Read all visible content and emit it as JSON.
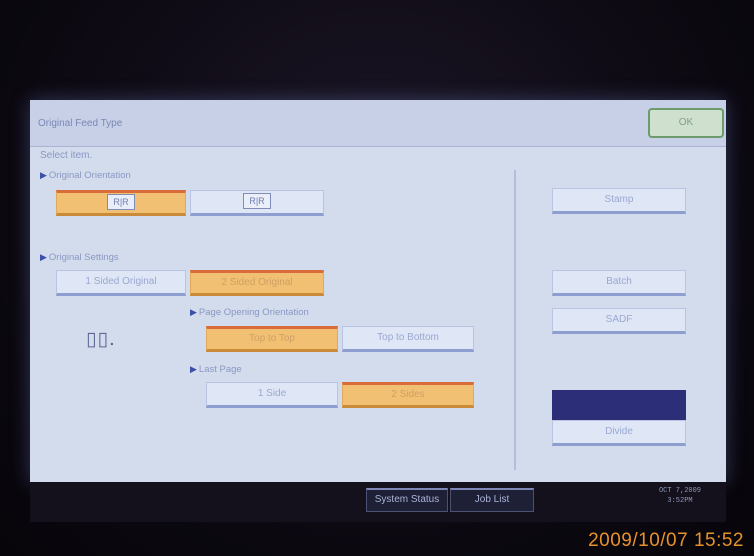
{
  "dialog": {
    "title": "Original Feed Type",
    "ok_label": "OK",
    "prompt": "Select item."
  },
  "original_orientation": {
    "label": "Original Orientation",
    "options": [
      {
        "icon": "readable-direction-icon",
        "glyph": "R|R",
        "selected": true
      },
      {
        "icon": "unreadable-direction-icon",
        "glyph": "R|R",
        "selected": false
      }
    ]
  },
  "original_settings": {
    "label": "Original Settings",
    "options": [
      {
        "label": "1 Sided Original",
        "selected": false
      },
      {
        "label": "2 Sided Original",
        "selected": true
      }
    ]
  },
  "page_opening_orientation": {
    "label": "Page Opening Orientation",
    "options": [
      {
        "label": "Top to Top",
        "selected": true
      },
      {
        "label": "Top to Bottom",
        "selected": false
      }
    ]
  },
  "last_page": {
    "label": "Last Page",
    "options": [
      {
        "label": "1 Side",
        "selected": false
      },
      {
        "label": "2 Sides",
        "selected": true
      }
    ]
  },
  "side_buttons": {
    "stamp": "Stamp",
    "batch": "Batch",
    "sadf": "SADF",
    "divide": "Divide"
  },
  "status_bar": {
    "system_status": "System Status",
    "job_list": "Job List",
    "clock_date": "OCT 7,2009",
    "clock_time": "3:52PM"
  },
  "photo_timestamp": "2009/10/07 15:52",
  "colors": {
    "selected": "#f2c073",
    "unselected": "#dfe6f5",
    "screen_bg": "#d3dced",
    "timestamp": "#e8922a"
  }
}
